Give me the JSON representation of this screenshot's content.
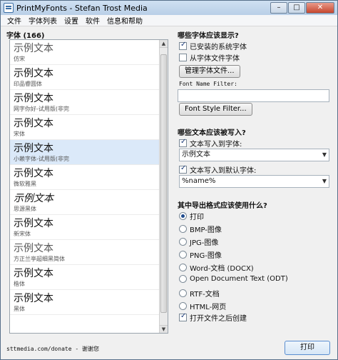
{
  "window": {
    "title": "PrintMyFonts - Stefan Trost Media",
    "buttons": {
      "minimize": "–",
      "maximize": "□",
      "close": "✕"
    }
  },
  "menu": [
    "文件",
    "字体列表",
    "设置",
    "软件",
    "信息和帮助"
  ],
  "font_list": {
    "header": "字体 (166)",
    "items": [
      {
        "sample": "示例文本",
        "name": "仿宋",
        "style": "light"
      },
      {
        "sample": "示例文本",
        "name": "印品睿圆体",
        "style": "normal"
      },
      {
        "sample": "示例文本",
        "name": "网字你好-试用版(非完",
        "style": "normal"
      },
      {
        "sample": "示例文本",
        "name": "宋体",
        "style": "normal"
      },
      {
        "sample": "示例文本",
        "name": "小赖字体-试用版(非完",
        "style": "normal",
        "selected": true
      },
      {
        "sample": "示例文本",
        "name": "微软雅黑",
        "style": "normal"
      },
      {
        "sample": "示例文本",
        "name": "思源黑体",
        "style": "italic"
      },
      {
        "sample": "示例文本",
        "name": "新宋体",
        "style": "normal"
      },
      {
        "sample": "示例文本",
        "name": "方正兰亭超细黑简体",
        "style": "light"
      },
      {
        "sample": "示例文本",
        "name": "楷体",
        "style": "normal"
      },
      {
        "sample": "示例文本",
        "name": "黑体",
        "style": "normal"
      }
    ]
  },
  "panel": {
    "which_fonts_title": "哪些字体应该显示?",
    "installed_fonts_label": "已安装的系统字体",
    "installed_fonts_checked": true,
    "from_file_label": "从字体文件字体",
    "from_file_checked": false,
    "manage_button": "管理字体文件...",
    "font_name_filter_label": "Font Name Filter:",
    "font_name_filter_value": "",
    "font_style_filter_button": "Font Style Filter...",
    "which_text_title": "哪些文本应该被写入?",
    "write_text_label": "文本写入到字体:",
    "write_text_checked": true,
    "write_text_select": "示例文本",
    "write_default_label": "文本写入到默认字体:",
    "write_default_checked": true,
    "write_default_select": "%name%",
    "format_title": "其中导出格式应该使用什么?",
    "formats": [
      {
        "label": "打印",
        "selected": true
      },
      {
        "label": "BMP-图像",
        "selected": false
      },
      {
        "label": "JPG-图像",
        "selected": false
      },
      {
        "label": "PNG-图像",
        "selected": false
      },
      {
        "label": "Word-文档 (DOCX)",
        "selected": false
      },
      {
        "label": "Open Document Text (ODT)",
        "selected": false
      },
      {
        "label": "RTF-文档",
        "selected": false
      },
      {
        "label": "HTML-网页",
        "selected": false
      }
    ],
    "open_after_label": "打开文件之后创建",
    "open_after_checked": true
  },
  "footer": {
    "link": "sttmedia.com/donate - 谢谢您",
    "print_button": "打印"
  }
}
